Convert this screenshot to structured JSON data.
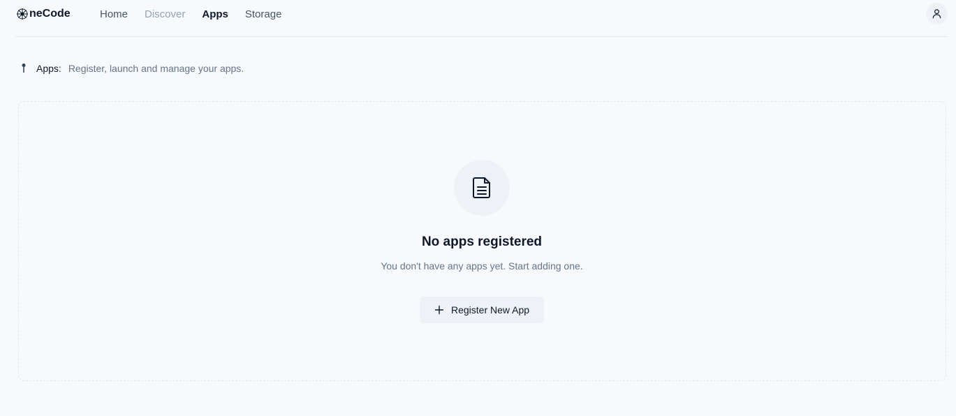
{
  "brand": {
    "name": "neCode",
    "icon": "logo-icon"
  },
  "nav": {
    "items": [
      {
        "label": "Home",
        "state": "normal"
      },
      {
        "label": "Discover",
        "state": "muted"
      },
      {
        "label": "Apps",
        "state": "active"
      },
      {
        "label": "Storage",
        "state": "normal"
      }
    ]
  },
  "user": {
    "icon": "user-icon"
  },
  "breadcrumb": {
    "icon": "pin-icon",
    "label": "Apps:",
    "description": "Register, launch and manage your apps."
  },
  "empty_state": {
    "icon": "document-icon",
    "title": "No apps registered",
    "subtitle": "You don't have any apps yet. Start adding one.",
    "button_label": "Register New App",
    "button_icon": "plus-icon"
  },
  "colors": {
    "background": "#f8f9fc",
    "muted_surface": "#eef1f6",
    "text_primary": "#0f172a",
    "text_secondary": "#64748b",
    "border": "#e5e7eb"
  }
}
